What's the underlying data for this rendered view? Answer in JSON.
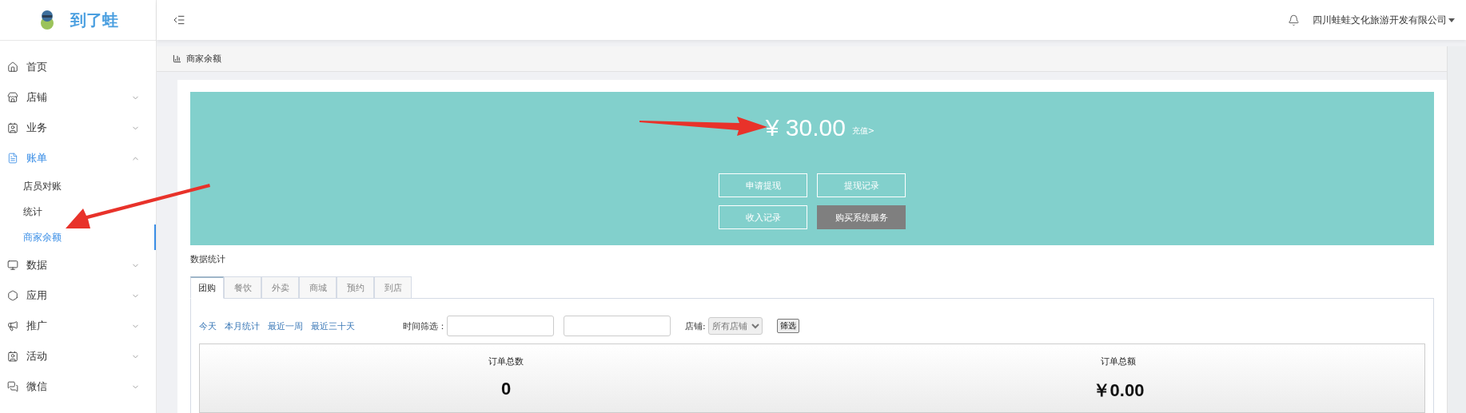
{
  "brand": {
    "name": "到了蛙"
  },
  "header": {
    "company": "四川蛙蛙文化旅游开发有限公司"
  },
  "sidebar": {
    "items": [
      {
        "label": "首页",
        "kind": "link",
        "selected": false
      },
      {
        "label": "店铺",
        "kind": "group",
        "expanded": false,
        "selected": false
      },
      {
        "label": "业务",
        "kind": "group",
        "expanded": false,
        "selected": false
      },
      {
        "label": "账单",
        "kind": "group",
        "expanded": true,
        "selected": true,
        "children": [
          {
            "label": "店员对账",
            "selected": false
          },
          {
            "label": "统计",
            "selected": false
          },
          {
            "label": "商家余额",
            "selected": true
          }
        ]
      },
      {
        "label": "数据",
        "kind": "group",
        "expanded": false,
        "selected": false
      },
      {
        "label": "应用",
        "kind": "group",
        "expanded": false,
        "selected": false
      },
      {
        "label": "推广",
        "kind": "group",
        "expanded": false,
        "selected": false
      },
      {
        "label": "活动",
        "kind": "group",
        "expanded": false,
        "selected": false
      },
      {
        "label": "微信",
        "kind": "group",
        "expanded": false,
        "selected": false
      }
    ]
  },
  "breadcrumb": {
    "title": "商家余额"
  },
  "balance": {
    "amount": "¥ 30.00",
    "recharge": "充值>",
    "buttons": [
      {
        "label": "申请提现",
        "kind": "outline"
      },
      {
        "label": "提现记录",
        "kind": "outline"
      },
      {
        "label": "收入记录",
        "kind": "outline"
      },
      {
        "label": "购买系统服务",
        "kind": "filled"
      }
    ]
  },
  "stats": {
    "title": "数据统计",
    "tabs": [
      {
        "label": "团购",
        "selected": true
      },
      {
        "label": "餐饮",
        "selected": false
      },
      {
        "label": "外卖",
        "selected": false
      },
      {
        "label": "商城",
        "selected": false
      },
      {
        "label": "预约",
        "selected": false
      },
      {
        "label": "到店",
        "selected": false
      }
    ],
    "quick_ranges": [
      "今天",
      "本月统计",
      "最近一周",
      "最近三十天"
    ],
    "time_label": "时间筛选：",
    "store_label": "店铺:",
    "store_select": "所有店铺",
    "filter_button": "筛选",
    "cards": [
      {
        "label": "订单总数",
        "value": "0"
      },
      {
        "label": "订单总额",
        "value": "￥0.00"
      }
    ]
  }
}
